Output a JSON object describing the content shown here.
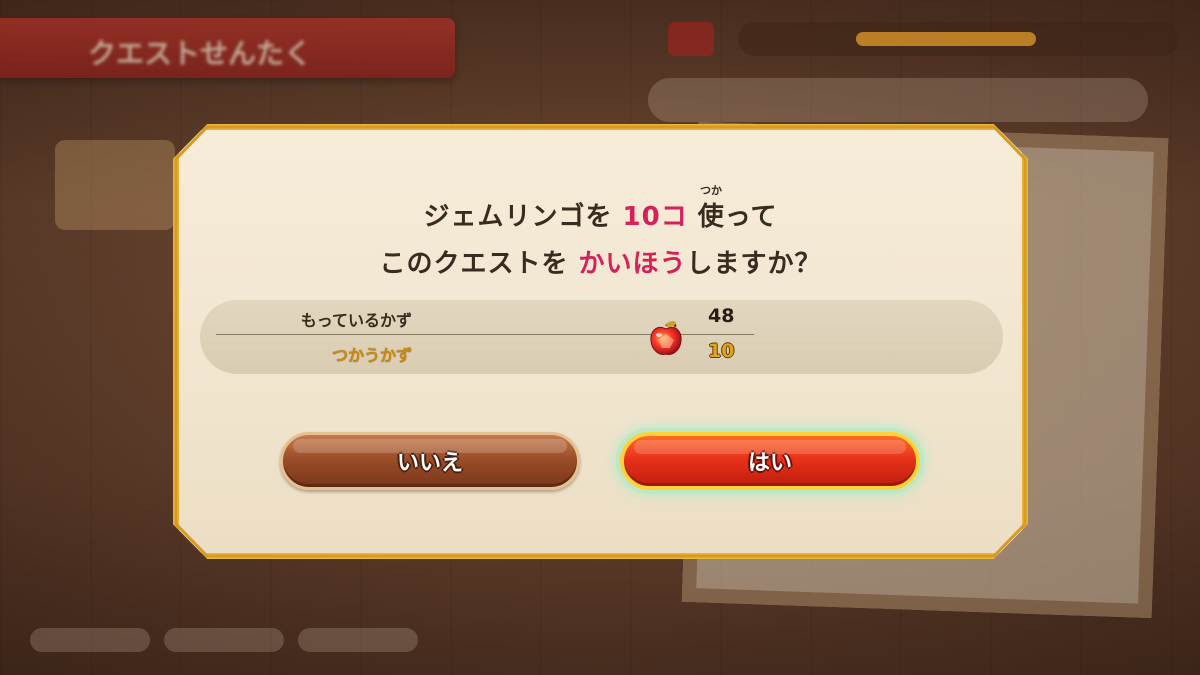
{
  "background": {
    "title_banner": "クエストせんたく"
  },
  "dialog": {
    "line1": {
      "part1": "ジェムリンゴを ",
      "highlight": "10コ",
      "part2": " 使って",
      "ruby": "つか"
    },
    "line2": {
      "part1": "このクエストを ",
      "highlight": "かいほう",
      "part2": "しますか？"
    },
    "counts": {
      "owned_label": "もっているかず",
      "owned_value": "48",
      "use_label": "つかうかず",
      "use_value": "10",
      "item_icon": "gem-apple-icon"
    },
    "buttons": {
      "no_label": "いいえ",
      "yes_label": "はい"
    }
  },
  "colors": {
    "highlight": "#d6205a",
    "frame": "#e8b63a",
    "yes_button": "#e8321a",
    "no_button": "#9b4e28"
  }
}
